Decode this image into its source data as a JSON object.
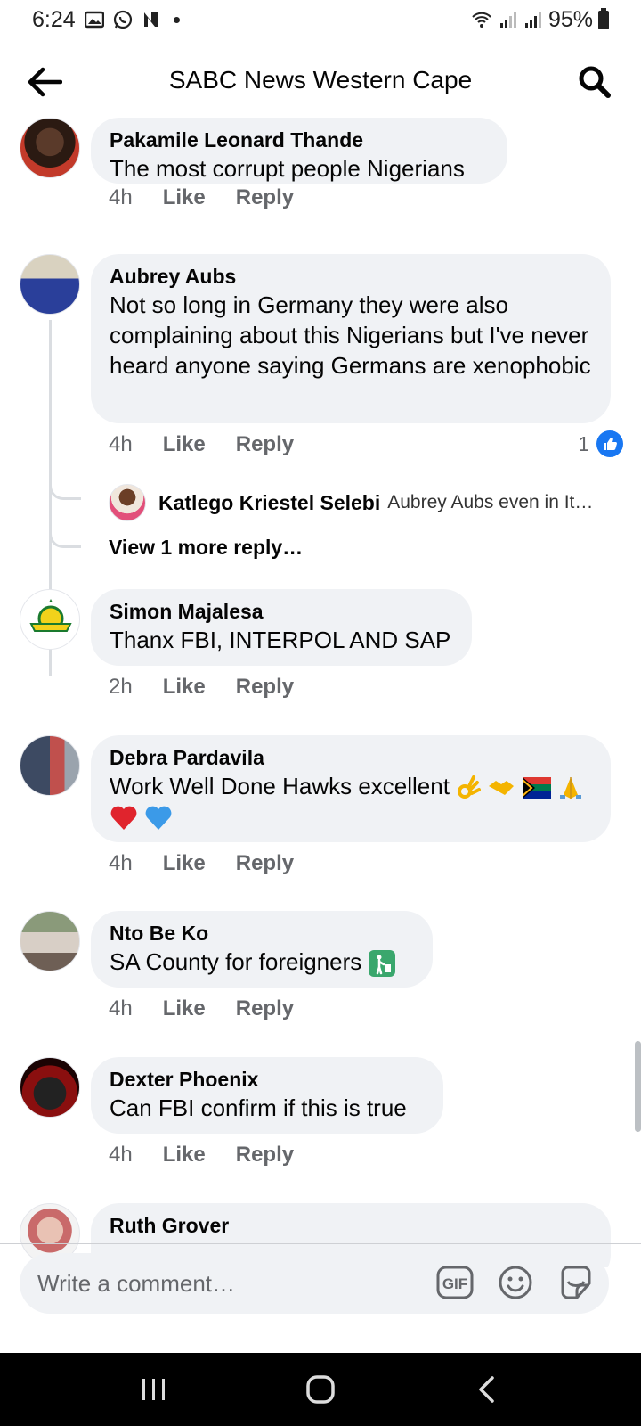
{
  "status_bar": {
    "time": "6:24",
    "battery": "95%"
  },
  "header": {
    "title": "SABC News Western Cape"
  },
  "comments": [
    {
      "author": "Pakamile Leonard Thande",
      "text": "The most corrupt people Nigerians",
      "time": "4h",
      "like": "Like",
      "reply": "Reply"
    },
    {
      "author": "Aubrey Aubs",
      "text": "Not so long in Germany they were also complaining about this Nigerians but I've never heard anyone saying Germans are xenophobic",
      "time": "4h",
      "like": "Like",
      "reply": "Reply",
      "reaction_count": "1",
      "reply_preview": {
        "author": "Katlego Kriestel Selebi",
        "text": "Aubrey Aubs even in It…"
      },
      "more_replies": "View 1 more reply…"
    },
    {
      "author": "Simon Majalesa",
      "text": "Thanx FBI, INTERPOL AND SAP",
      "time": "2h",
      "like": "Like",
      "reply": "Reply"
    },
    {
      "author": "Debra Pardavila",
      "text": "Work Well Done Hawks excellent",
      "time": "4h",
      "like": "Like",
      "reply": "Reply"
    },
    {
      "author": "Nto Be Ko",
      "text": "SA County for foreigners",
      "time": "4h",
      "like": "Like",
      "reply": "Reply"
    },
    {
      "author": "Dexter Phoenix",
      "text": "Can FBI confirm if this is true",
      "time": "4h",
      "like": "Like",
      "reply": "Reply"
    },
    {
      "author": "Ruth Grover"
    }
  ],
  "composer": {
    "placeholder": "Write a comment…"
  },
  "colors": {
    "bubble": "#f0f2f5",
    "muted": "#65676b",
    "like_blue": "#1877f2"
  }
}
